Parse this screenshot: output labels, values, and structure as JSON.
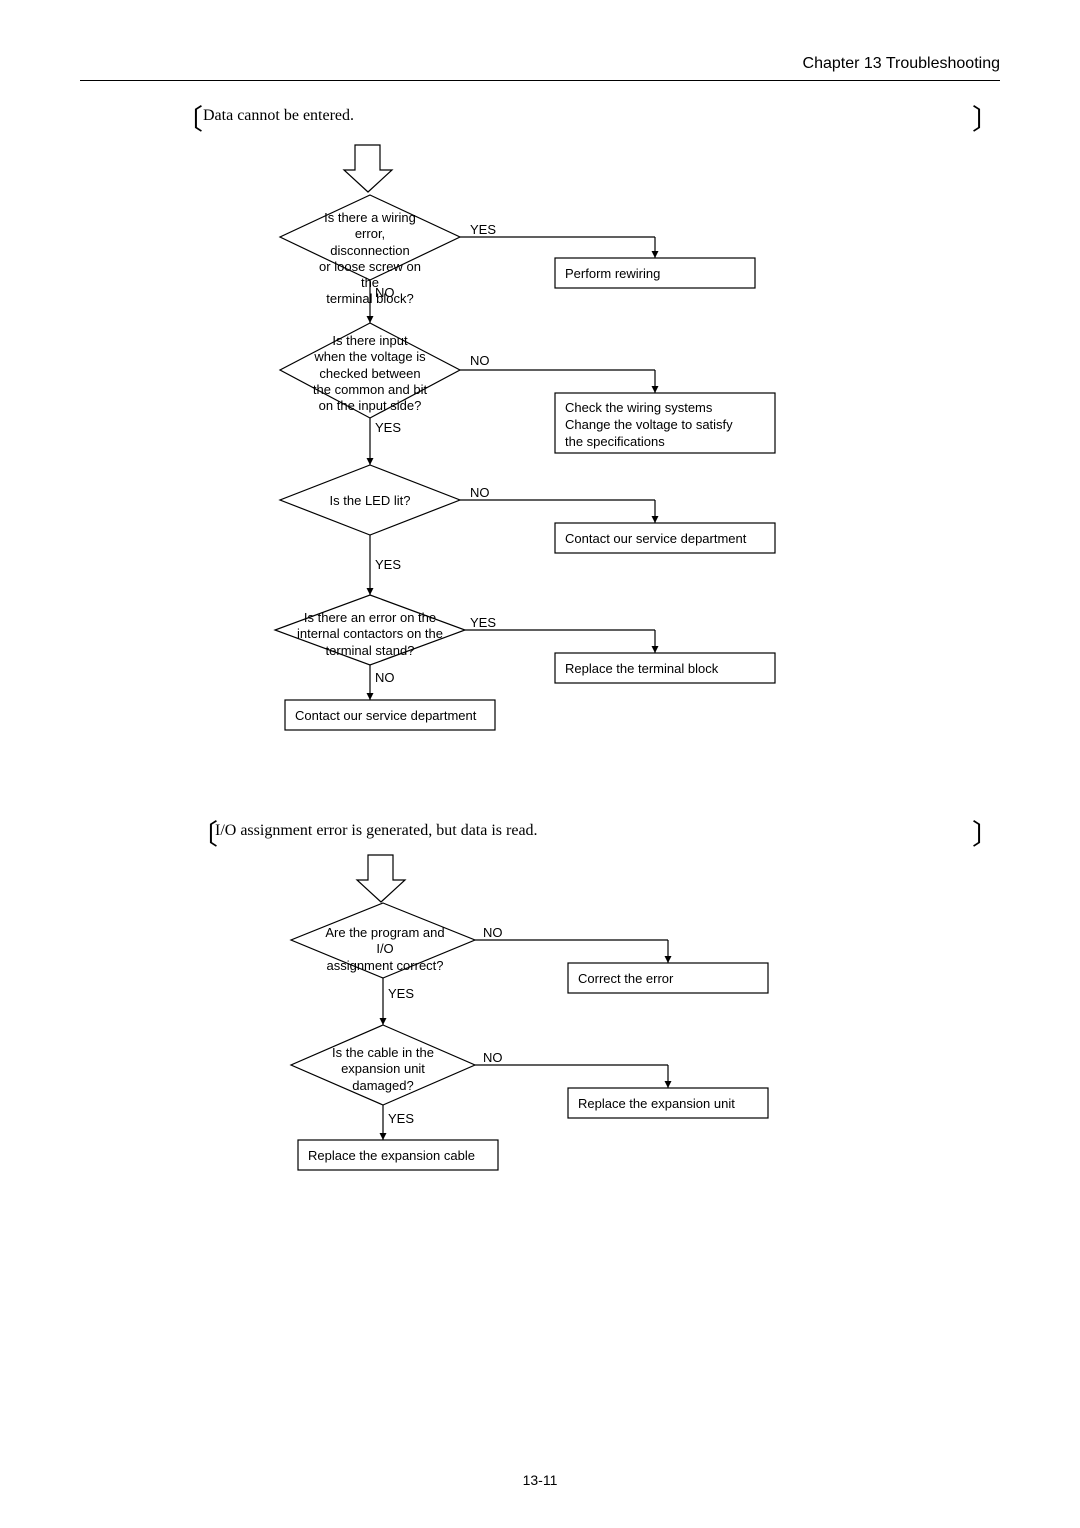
{
  "header": {
    "chapter": "Chapter 13  Troubleshooting"
  },
  "page_number": "13-11",
  "section1": {
    "title": "Data cannot be entered.",
    "d1": {
      "l1": "Is there a wiring",
      "l2": "error, disconnection",
      "l3": "or loose screw on the",
      "l4": "terminal block?",
      "yes": "YES",
      "no": "NO",
      "action": "Perform rewiring"
    },
    "d2": {
      "l1": "Is there input",
      "l2": "when the voltage is",
      "l3": "checked between",
      "l4": "the common and bit",
      "l5": "on the input side?",
      "yes": "YES",
      "no": "NO",
      "action": "Check the wiring systems\nChange the voltage to satisfy\nthe specifications"
    },
    "d3": {
      "text": "Is the LED lit?",
      "yes": "YES",
      "no": "NO",
      "action": "Contact our service department"
    },
    "d4": {
      "l1": "Is there an error on the",
      "l2": "internal contactors on the",
      "l3": "terminal stand?",
      "yes": "YES",
      "no": "NO",
      "action": "Replace the terminal block",
      "final": "Contact our service department"
    }
  },
  "section2": {
    "title": "I/O assignment error is generated, but data is read.",
    "d1": {
      "l1": "Are the program and I/O",
      "l2": "assignment correct?",
      "yes": "YES",
      "no": "NO",
      "action": "Correct the error"
    },
    "d2": {
      "l1": "Is the cable in the",
      "l2": "expansion unit",
      "l3": "damaged?",
      "yes": "YES",
      "no": "NO",
      "action": "Replace the expansion unit",
      "final": "Replace the expansion cable"
    }
  }
}
